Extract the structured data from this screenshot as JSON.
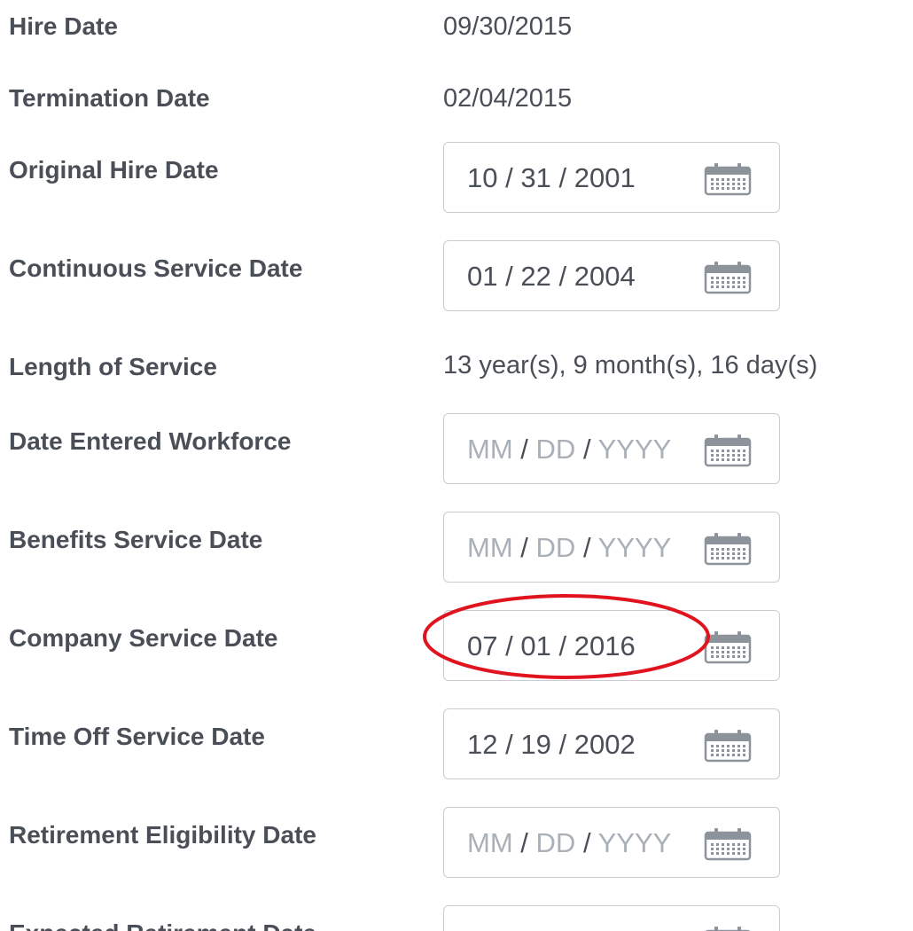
{
  "fields": {
    "hire_date": {
      "label": "Hire Date",
      "value": "09/30/2015"
    },
    "termination_date": {
      "label": "Termination Date",
      "value": "02/04/2015"
    },
    "original_hire_date": {
      "label": "Original Hire Date",
      "month": "10",
      "day": "31",
      "year": "2001"
    },
    "continuous_service_date": {
      "label": "Continuous Service Date",
      "month": "01",
      "day": "22",
      "year": "2004"
    },
    "length_of_service": {
      "label": "Length of Service",
      "value": "13 year(s), 9 month(s), 16 day(s)"
    },
    "date_entered_workforce": {
      "label": "Date Entered Workforce",
      "month": "MM",
      "day": "DD",
      "year": "YYYY"
    },
    "benefits_service_date": {
      "label": "Benefits Service Date",
      "month": "MM",
      "day": "DD",
      "year": "YYYY"
    },
    "company_service_date": {
      "label": "Company Service Date",
      "month": "07",
      "day": "01",
      "year": "2016"
    },
    "time_off_service_date": {
      "label": "Time Off Service Date",
      "month": "12",
      "day": "19",
      "year": "2002"
    },
    "retirement_eligibility_date": {
      "label": "Retirement Eligibility Date",
      "month": "MM",
      "day": "DD",
      "year": "YYYY"
    },
    "expected_retirement_date": {
      "label": "Expected Retirement Date"
    }
  },
  "separator": "/",
  "icons": {
    "calendar": "calendar-icon",
    "highlight": "highlight-circle"
  },
  "colors": {
    "label_text": "#4a4f57",
    "placeholder_text": "#a9b0b8",
    "field_border": "#c9ccd1",
    "highlight_circle": "#e0141e"
  }
}
